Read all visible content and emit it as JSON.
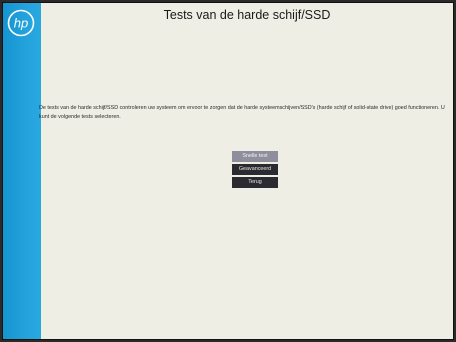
{
  "page": {
    "title": "Tests van de harde schijf/SSD",
    "description": "De tests van de harde schijf/SSD controleren uw systeem om ervoor te zorgen dat de harde systeemschijven/SSD's (harde schijf of solid-state drive) goed functioneren. U kunt de volgende tests selecteren."
  },
  "logo": {
    "text": "hp",
    "icon": "hp-logo-icon"
  },
  "buttons": [
    {
      "label": "Snelle test",
      "selected": true
    },
    {
      "label": "Geavanceerd",
      "selected": false
    },
    {
      "label": "Terug",
      "selected": false
    }
  ],
  "colors": {
    "sidebar": "#23a2dc",
    "background": "#efeee4",
    "button": "#2b2a30",
    "button_selected": "#8e8e9c"
  }
}
